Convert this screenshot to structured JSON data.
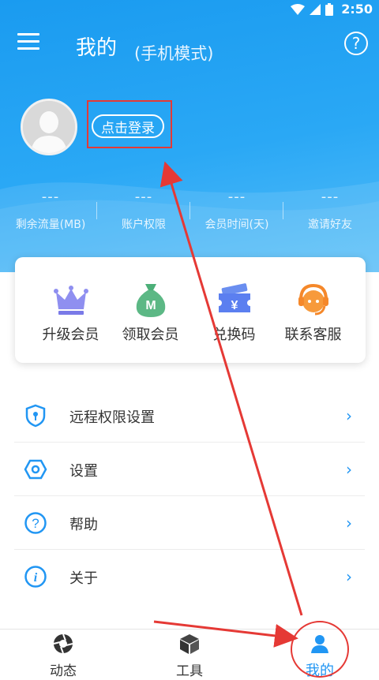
{
  "status_bar": {
    "time": "2:50"
  },
  "header": {
    "title": "我的",
    "subtitle": "(手机模式)",
    "login_button": "点击登录"
  },
  "stats": [
    {
      "value": "---",
      "label": "剩余流量(MB)"
    },
    {
      "value": "---",
      "label": "账户权限"
    },
    {
      "value": "---",
      "label": "会员时间(天)"
    },
    {
      "value": "---",
      "label": "邀请好友"
    }
  ],
  "features": [
    {
      "label": "升级会员",
      "icon": "crown-icon"
    },
    {
      "label": "领取会员",
      "icon": "money-bag-icon"
    },
    {
      "label": "兑换码",
      "icon": "ticket-icon"
    },
    {
      "label": "联系客服",
      "icon": "customer-service-icon"
    }
  ],
  "menu": [
    {
      "label": "远程权限设置",
      "icon": "shield-icon"
    },
    {
      "label": "设置",
      "icon": "hexagon-settings-icon"
    },
    {
      "label": "帮助",
      "icon": "question-icon"
    },
    {
      "label": "关于",
      "icon": "info-icon"
    }
  ],
  "tabs": [
    {
      "label": "动态",
      "icon": "aperture-icon"
    },
    {
      "label": "工具",
      "icon": "box-icon"
    },
    {
      "label": "我的",
      "icon": "person-icon"
    }
  ],
  "colors": {
    "primary": "#2196f3",
    "header_start": "#1a9bf0",
    "header_end": "#55bdf8",
    "annotation_red": "#e53935"
  }
}
